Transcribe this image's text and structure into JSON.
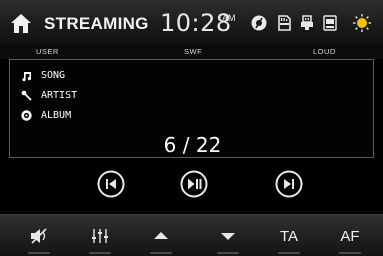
{
  "header": {
    "title": "STREAMING",
    "time": "10:28",
    "ampm": "AM",
    "status_icons": [
      "bluetooth-audio-icon",
      "sd-card-icon",
      "usb-icon",
      "phone-bt-icon",
      "weather-sun-icon"
    ]
  },
  "subheader": {
    "user_label": "USER",
    "swf_label": "SWF",
    "loud_label": "LOUD"
  },
  "track_info": {
    "song_label": "SONG",
    "artist_label": "ARTIST",
    "album_label": "ALBUM",
    "track_counter": "6 / 22"
  },
  "transport": [
    "previous-button",
    "play-pause-button",
    "next-button"
  ],
  "bottom_bar": {
    "mute_icon": "mute-icon",
    "eq_icon": "equalizer-icon",
    "up_icon": "arrow-up-icon",
    "down_icon": "arrow-down-icon",
    "ta_label": "TA",
    "af_label": "AF"
  }
}
